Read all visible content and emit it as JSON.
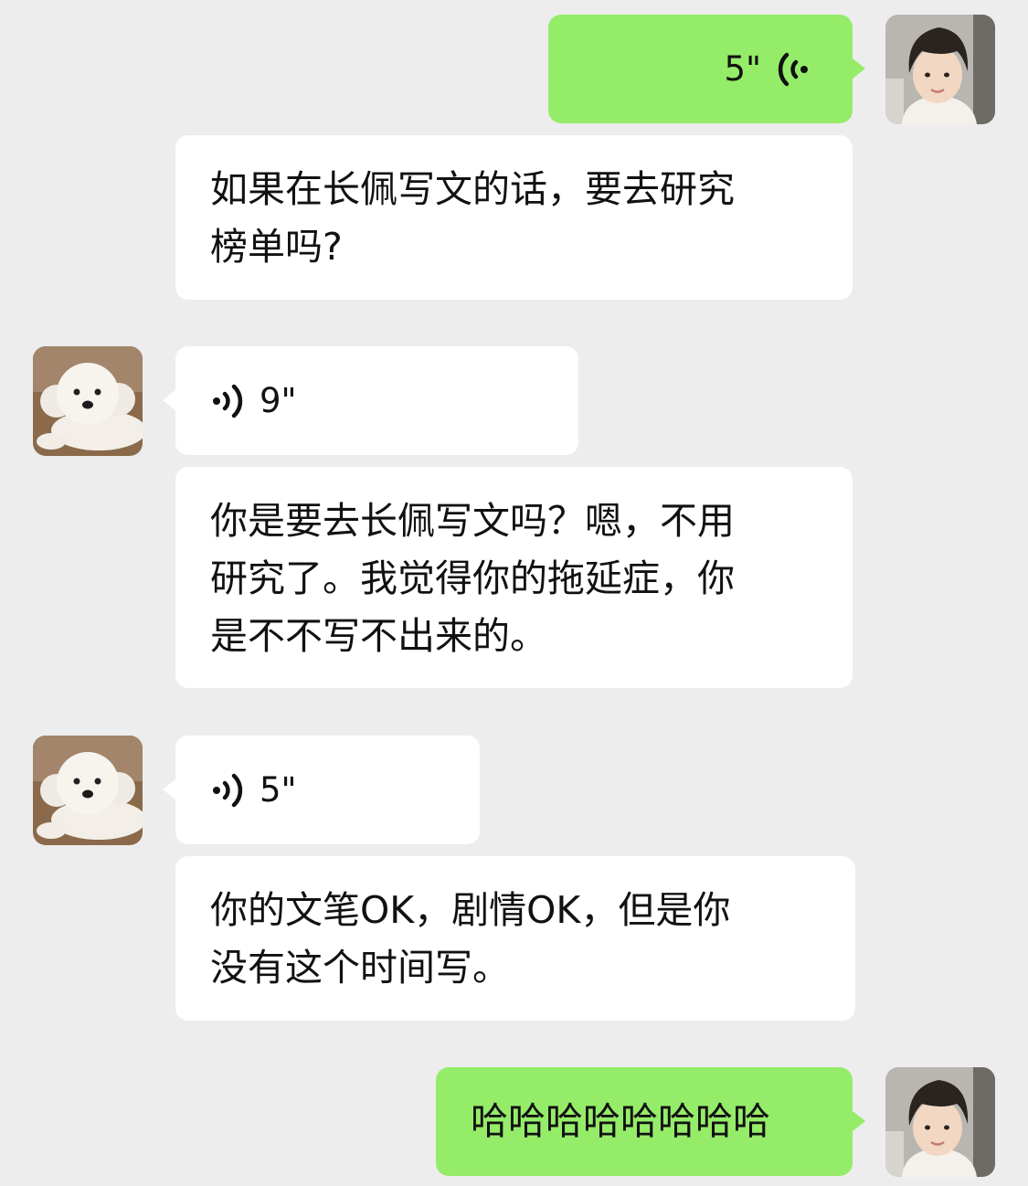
{
  "colors": {
    "background": "#ededed",
    "incoming_bubble": "#ffffff",
    "outgoing_bubble": "#95ec69"
  },
  "messages": [
    {
      "sender": "me",
      "kind": "voice",
      "duration": "5\""
    },
    {
      "sender": "me",
      "kind": "transcript",
      "lines": [
        "如果在长佩写文的话，要去研究",
        "榜单吗?"
      ]
    },
    {
      "sender": "friend",
      "kind": "voice",
      "duration": "9\""
    },
    {
      "sender": "friend",
      "kind": "transcript",
      "lines": [
        "你是要去长佩写文吗？嗯，不用",
        "研究了。我觉得你的拖延症，你",
        "是不不写不出来的。"
      ]
    },
    {
      "sender": "friend",
      "kind": "voice",
      "duration": "5\""
    },
    {
      "sender": "friend",
      "kind": "transcript",
      "lines": [
        "你的文笔OK，剧情OK，但是你",
        "没有这个时间写。"
      ]
    },
    {
      "sender": "me",
      "kind": "text",
      "text": "哈哈哈哈哈哈哈哈"
    }
  ],
  "icons": {
    "voice_wave": "voice-wave-icon",
    "my_avatar": "user-avatar",
    "friend_avatar": "dog-avatar"
  }
}
